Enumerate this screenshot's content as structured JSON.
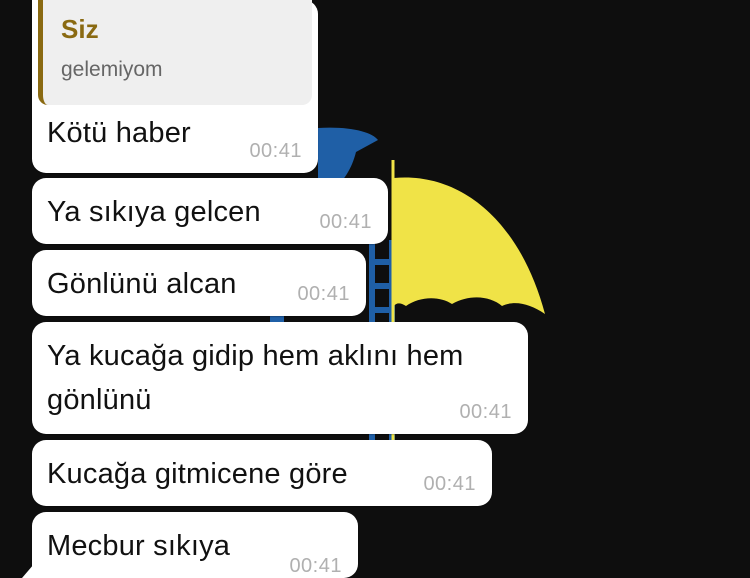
{
  "chat": {
    "messages": [
      {
        "quote_author": "Siz",
        "quote_text": "gelemiyom",
        "text": "Kötü haber",
        "time": "00:41"
      },
      {
        "text": "Ya sıkıya gelcen",
        "time": "00:41"
      },
      {
        "text": "Gönlünü alcan",
        "time": "00:41"
      },
      {
        "text": "Ya kucağa gidip hem aklını hem gönlünü",
        "time": "00:41"
      },
      {
        "text": "Kucağa gitmicene göre",
        "time": "00:41"
      },
      {
        "text": "Mecbur sıkıya",
        "time": "00:41"
      }
    ]
  },
  "colors": {
    "background": "#0e0e0e",
    "bubble": "#ffffff",
    "quote_accent": "#8a6a12",
    "wallpaper_blue": "#1f5fa6",
    "wallpaper_yellow": "#f0e347"
  }
}
